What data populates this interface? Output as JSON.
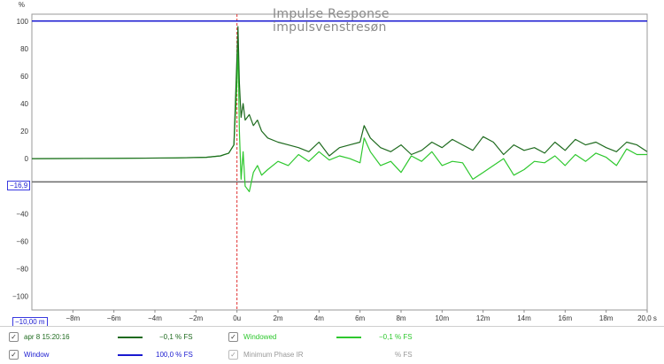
{
  "chart_data": {
    "type": "line",
    "title": "Impulse Response",
    "subtitle": "impulsvenstresøn",
    "ylabel": "%",
    "x_unit": "s",
    "xlim": [
      -0.01,
      0.02
    ],
    "ylim": [
      -110,
      105
    ],
    "x_ticks": [
      "−8m",
      "−6m",
      "−4m",
      "−2m",
      "0u",
      "2m",
      "4m",
      "6m",
      "8m",
      "10m",
      "12m",
      "14m",
      "16m",
      "18m",
      "20,0 s"
    ],
    "y_ticks": [
      "100",
      "80",
      "60",
      "40",
      "20",
      "0",
      "−20",
      "−40",
      "−60",
      "−80",
      "−100"
    ],
    "cursor_x_label": "−10,00 m",
    "cursor_y_label": "−16,9",
    "grid": true,
    "series": [
      {
        "name": "apr 8 15:20:16",
        "color": "#1f6b1f",
        "x": [
          -0.01,
          -0.006,
          -0.003,
          -0.0015,
          -0.0008,
          -0.0004,
          -0.00015,
          0.0,
          5e-05,
          0.00012,
          0.0002,
          0.0003,
          0.0004,
          0.0006,
          0.0008,
          0.001,
          0.0012,
          0.0015,
          0.002,
          0.0025,
          0.003,
          0.0035,
          0.004,
          0.0045,
          0.005,
          0.0055,
          0.006,
          0.0062,
          0.0065,
          0.007,
          0.0075,
          0.008,
          0.0085,
          0.009,
          0.0095,
          0.01,
          0.0105,
          0.011,
          0.0115,
          0.012,
          0.0125,
          0.013,
          0.0135,
          0.014,
          0.0145,
          0.015,
          0.0155,
          0.016,
          0.0165,
          0.017,
          0.0175,
          0.018,
          0.0185,
          0.019,
          0.0195,
          0.02
        ],
        "y": [
          0,
          0.2,
          0.5,
          1,
          2,
          4,
          10,
          75,
          96,
          55,
          30,
          40,
          28,
          32,
          24,
          28,
          20,
          15,
          12,
          10,
          8,
          5,
          12,
          2,
          8,
          10,
          12,
          24,
          15,
          8,
          5,
          10,
          3,
          6,
          12,
          8,
          14,
          10,
          6,
          16,
          12,
          3,
          10,
          6,
          8,
          4,
          12,
          6,
          14,
          10,
          12,
          8,
          5,
          12,
          10,
          5
        ]
      },
      {
        "name": "Windowed",
        "color": "#2ec82e",
        "x": [
          -0.01,
          -0.006,
          -0.003,
          -0.0015,
          -0.0008,
          -0.0004,
          -0.00015,
          0.0,
          5e-05,
          0.00012,
          0.0002,
          0.0003,
          0.0004,
          0.0006,
          0.0008,
          0.001,
          0.0012,
          0.0015,
          0.002,
          0.0025,
          0.003,
          0.0035,
          0.004,
          0.0045,
          0.005,
          0.0055,
          0.006,
          0.0062,
          0.0065,
          0.007,
          0.0075,
          0.008,
          0.0085,
          0.009,
          0.0095,
          0.01,
          0.0105,
          0.011,
          0.0115,
          0.012,
          0.0125,
          0.013,
          0.0135,
          0.014,
          0.0145,
          0.015,
          0.0155,
          0.016,
          0.0165,
          0.017,
          0.0175,
          0.018,
          0.0185,
          0.019,
          0.0195,
          0.02
        ],
        "y": [
          0,
          0.2,
          0.5,
          1,
          2,
          4,
          10,
          55,
          85,
          20,
          -15,
          5,
          -20,
          -24,
          -10,
          -5,
          -12,
          -8,
          -2,
          -5,
          3,
          -2,
          5,
          -1,
          2,
          0,
          -3,
          15,
          5,
          -5,
          -2,
          -10,
          2,
          -2,
          5,
          -5,
          -2,
          -3,
          -15,
          -10,
          -5,
          0,
          -12,
          -8,
          -2,
          -3,
          2,
          -5,
          3,
          -2,
          4,
          1,
          -5,
          7,
          3,
          3
        ]
      },
      {
        "name": "Window",
        "color": "#1a1ad0",
        "x": [
          -0.01,
          0.02
        ],
        "y": [
          100,
          100
        ]
      }
    ]
  },
  "legend": {
    "rows": [
      [
        {
          "check": "✓",
          "label": "apr 8 15:20:16",
          "value": "−0,1 % FS",
          "color": "#1f6b1f"
        },
        {
          "check": "✓",
          "label": "Windowed",
          "value": "−0,1 % FS",
          "color": "#2ec82e"
        }
      ],
      [
        {
          "check": "✓",
          "label": "Window",
          "value": "100,0 % FS",
          "color": "#1a1ad0"
        },
        {
          "check": "✓",
          "label": "Minimum Phase IR",
          "value": "% FS",
          "color": "#999999"
        }
      ]
    ]
  }
}
